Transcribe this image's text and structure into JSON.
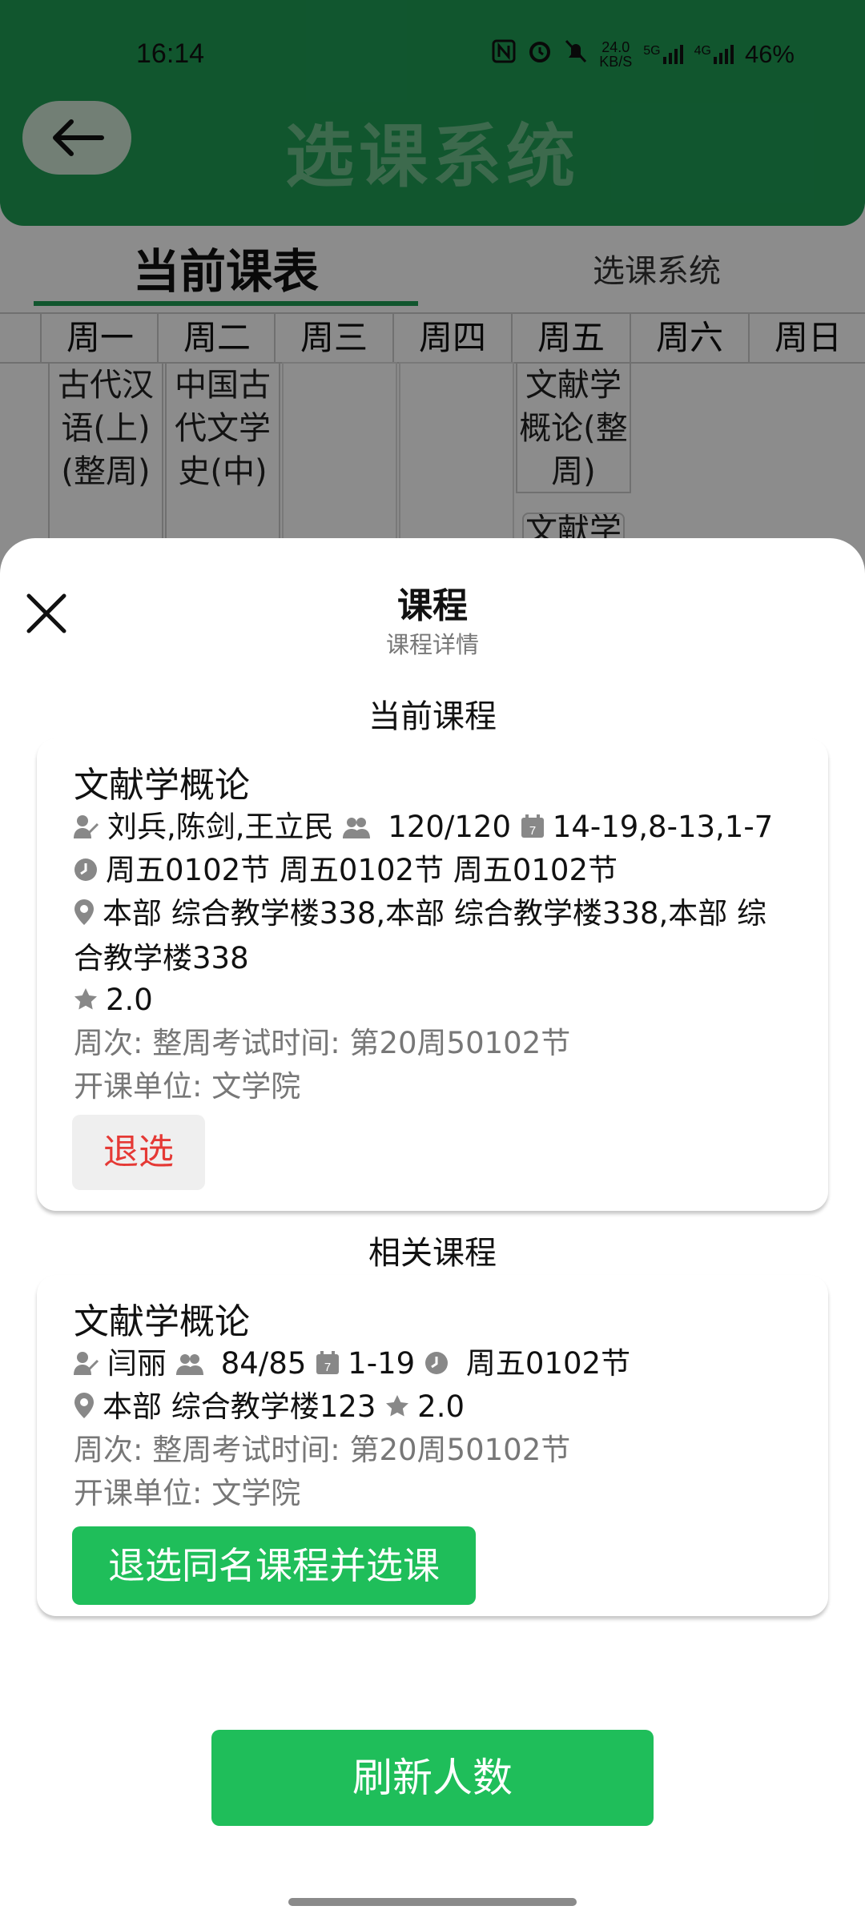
{
  "status_bar": {
    "time": "16:14",
    "net_speed_top": "24.0",
    "net_speed_bottom": "KB/S",
    "net_type_1": "5G",
    "net_type_2": "4G",
    "battery": "46%"
  },
  "header": {
    "title": "选课系统"
  },
  "tabs": {
    "current": "当前课表",
    "other": "选课系统"
  },
  "schedule": {
    "days": [
      "周一",
      "周二",
      "周三",
      "周四",
      "周五",
      "周六",
      "周日"
    ],
    "cells": {
      "mon": "古代汉语(上)(整周)",
      "tue": "中国古代文学史(中)",
      "fri": "文献学概论(整周)",
      "fri_second": "文献学"
    }
  },
  "sheet": {
    "title": "课程",
    "subtitle": "课程详情",
    "current_section": "当前课程",
    "related_section": "相关课程",
    "refresh_button": "刷新人数"
  },
  "current_course": {
    "name": "文献学概论",
    "teachers": "刘兵,陈剑,王立民",
    "enrollment": "120/120",
    "weeks": "14-19,8-13,1-7",
    "time": "周五0102节 周五0102节 周五0102节",
    "location": "本部 综合教学楼338,本部 综合教学楼338,本部 综合教学楼338",
    "credits": "2.0",
    "week_info": "周次: 整周考试时间: 第20周50102节",
    "department": "开课单位: 文学院",
    "drop_button": "退选"
  },
  "related_course": {
    "name": "文献学概论",
    "teacher": "闫丽",
    "enrollment": "84/85",
    "weeks": "1-19",
    "time": "周五0102节",
    "location": "本部 综合教学楼123",
    "credits": "2.0",
    "week_info": "周次: 整周考试时间: 第20周50102节",
    "department": "开课单位: 文学院",
    "action_button": "退选同名课程并选课"
  },
  "colors": {
    "brand_green": "#1f9d55",
    "button_green": "#1fbe5a",
    "drop_red": "#e53935"
  }
}
